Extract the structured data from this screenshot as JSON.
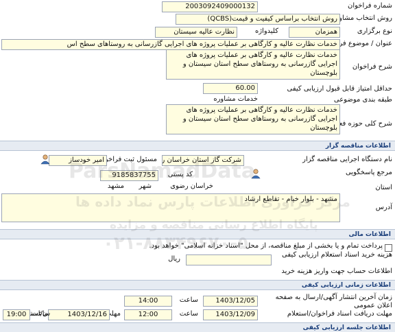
{
  "fields": {
    "announce_no": {
      "label": "شماره فراخوان",
      "value": "2003092409000132"
    },
    "selection_method": {
      "label": "روش انتخاب مشاور",
      "value": "روش انتخاب براساس کیفیت و قیمت(QCBS)"
    },
    "holding_type": {
      "label": "نوع برگزاری",
      "value": "همزمان",
      "keyword_label": "کلیدواژه",
      "keyword_value": "نظارت عالیه سیستان"
    },
    "subject": {
      "label": "عنوان / موضوع فراخوان",
      "value": "خدمات نظارت عالیه و کارگاهی بر عملیات پروژه های اجرایی گازرسانی به روستاهای سطح اس"
    },
    "description": {
      "label": "شرح فراخوان",
      "value": "خدمات نظارت عالیه و کارگاهی بر عملیات پروژه های اجرایی گازرسانی به روستاهای سطح استان سیستان و بلوچستان"
    },
    "min_score": {
      "label": "حداقل امتیاز قابل قبول ارزیابی کیفی",
      "value": "60.00"
    },
    "category": {
      "label": "طبقه بندی موضوعی",
      "value": "خدمات مشاوره"
    },
    "activity": {
      "label": "شرح کلی حوزه فعالیت",
      "value": "خدمات نظارت عالیه و کارگاهی بر عملیات پروژه های اجرایی گازرسانی به روستاهای سطح استان سیستان و بلوچستان"
    }
  },
  "sections": {
    "tender_holder": "اطلاعات مناقصه گزار",
    "financial": "اطلاعات مالی",
    "timing": "اطلاعات زمانی ارزیابی کیفی"
  },
  "tender_holder": {
    "org_label": "نام دستگاه اجرایی مناقصه گزار",
    "org_value": "شرکت گاز استان خراسان رض",
    "registrar_label": "مسئول ثبت فراخوان",
    "registrar_value": "امیر خودساز",
    "ref_label": "مرجع پاسخگویی",
    "postal_label": "کد پستی",
    "postal_value": "9185837755",
    "province_label": "استان",
    "province_value": "خراسان رضوی",
    "city_label": "شهر",
    "city_value": "مشهد",
    "address_label": "آدرس",
    "address_value": "مشهد - بلوار خیام - تقاطع ارشاد"
  },
  "financial": {
    "payment_text": "پرداخت تمام و یا بخشی از مبلغ مناقصه، از محل \"اسناد خزانه اسلامی\" خواهد بود.",
    "doc_cost_label": "هزینه خرید اسناد استعلام ارزیابی کیفی",
    "currency": "ریال",
    "account_label": "اطلاعات حساب جهت واریز هزینه خرید"
  },
  "timing": {
    "publish_label": "زمان آخرین انتشار آگهی/ارسال به صفحه اعلان عمومی",
    "publish_date": "1403/12/05",
    "publish_time": "14:00",
    "time_label": "ساعت",
    "receive_label": "مهلت دریافت اسناد فراخوان/استعلام",
    "receive_date": "1403/12/09",
    "receive_time": "12:00",
    "deadline_label": "مهلت ارسال پاسخ فراخوان/استعلام",
    "deadline_date": "1403/12/16",
    "deadline_time": "19:00",
    "next_section": "اطلاعات جلسه ارزیابی کیفی"
  },
  "watermark": {
    "line1": "ParsNamadData",
    "line2": "مرکز فراوری اطلاعات پارس نماد داده ها",
    "line3": "پایگاه اطلاع رسانی مناقصه و مزایده",
    "line4": "۰۲۱-۸۸۳۴۹۶۷۰-۵"
  }
}
